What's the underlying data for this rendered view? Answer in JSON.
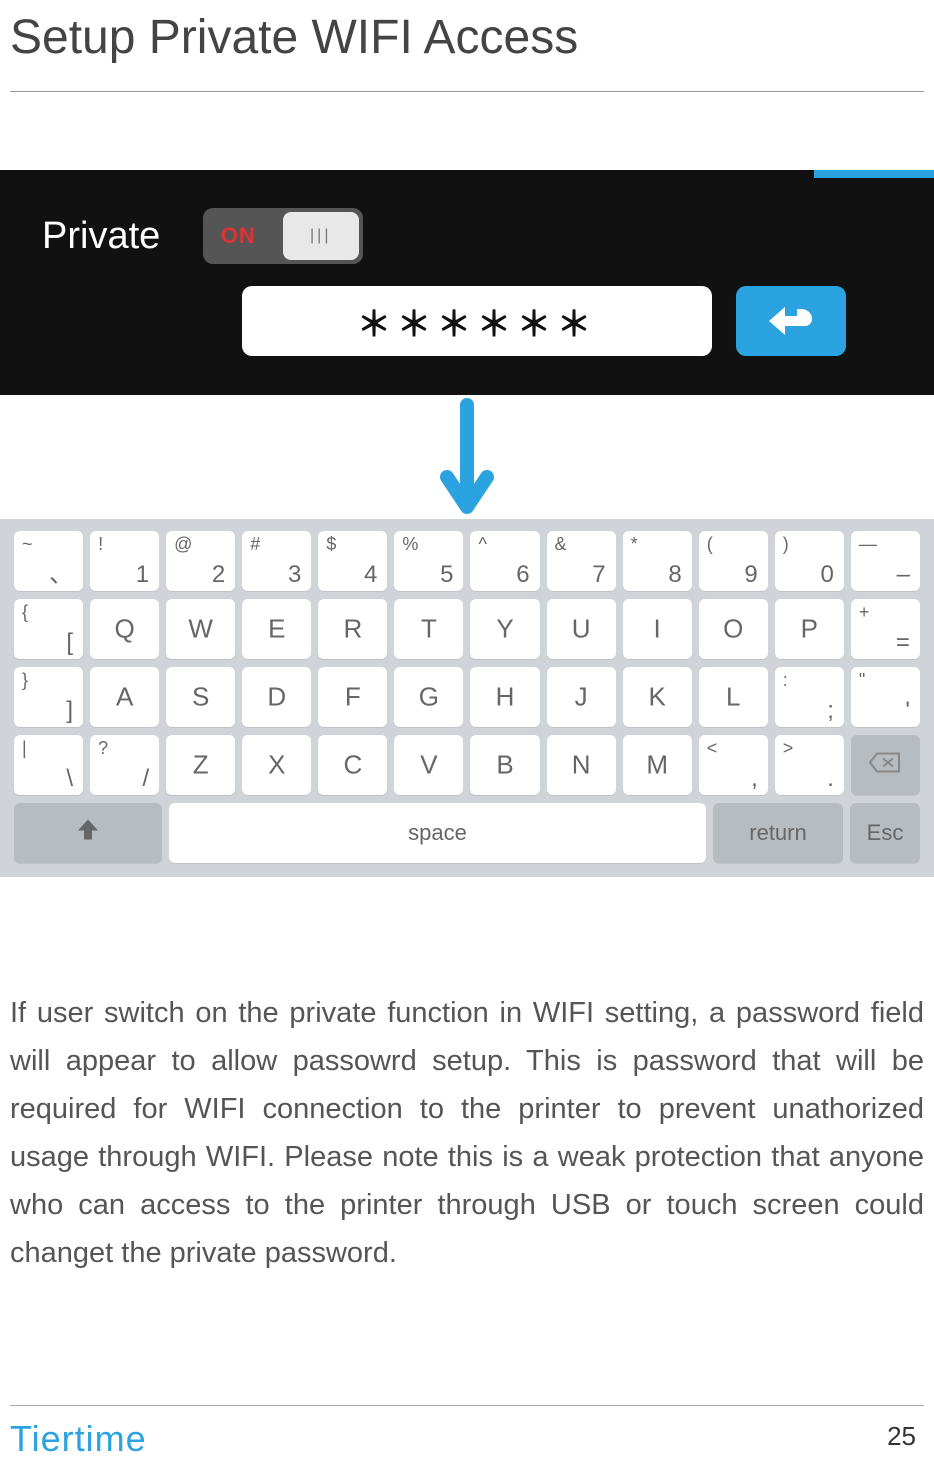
{
  "title": "Setup Private WIFI Access",
  "panel": {
    "private_label": "Private",
    "toggle_on": "ON",
    "toggle_knob_glyph": "|||",
    "password_masked": "＊＊＊＊＊＊"
  },
  "arrow_icon": "down-arrow",
  "keyboard": {
    "row1": [
      {
        "tl": "~",
        "br": "、"
      },
      {
        "tl": "!",
        "br": "1"
      },
      {
        "tl": "@",
        "br": "2"
      },
      {
        "tl": "#",
        "br": "3"
      },
      {
        "tl": "$",
        "br": "4"
      },
      {
        "tl": "%",
        "br": "5"
      },
      {
        "tl": "^",
        "br": "6"
      },
      {
        "tl": "&",
        "br": "7"
      },
      {
        "tl": "*",
        "br": "8"
      },
      {
        "tl": "(",
        "br": "9"
      },
      {
        "tl": ")",
        "br": "0"
      },
      {
        "tl": "—",
        "br": "–"
      }
    ],
    "row2": [
      {
        "tl": "{",
        "br": "["
      },
      {
        "c": "Q"
      },
      {
        "c": "W"
      },
      {
        "c": "E"
      },
      {
        "c": "R"
      },
      {
        "c": "T"
      },
      {
        "c": "Y"
      },
      {
        "c": "U"
      },
      {
        "c": "I"
      },
      {
        "c": "O"
      },
      {
        "c": "P"
      },
      {
        "tl": "+",
        "br": "="
      }
    ],
    "row3": [
      {
        "tl": "}",
        "br": "]"
      },
      {
        "c": "A"
      },
      {
        "c": "S"
      },
      {
        "c": "D"
      },
      {
        "c": "F"
      },
      {
        "c": "G"
      },
      {
        "c": "H"
      },
      {
        "c": "J"
      },
      {
        "c": "K"
      },
      {
        "c": "L"
      },
      {
        "tl": ":",
        "br": ";"
      },
      {
        "tl": "\"",
        "br": "'"
      }
    ],
    "row4": [
      {
        "tl": "|",
        "br": "\\"
      },
      {
        "tl": "?",
        "br": "/"
      },
      {
        "c": "Z"
      },
      {
        "c": "X"
      },
      {
        "c": "C"
      },
      {
        "c": "V"
      },
      {
        "c": "B"
      },
      {
        "c": "N"
      },
      {
        "c": "M"
      },
      {
        "tl": "<",
        "br": ","
      },
      {
        "tl": ">",
        "br": "."
      },
      {
        "bksp": true
      }
    ],
    "row5": {
      "shift": "⇧",
      "space": "space",
      "return": "return",
      "esc": "Esc"
    }
  },
  "body_text": "If user switch on the private function in WIFI setting, a password field will appear to allow passowrd setup. This is password that will be required for WIFI connection to the printer to prevent unathorized usage through WIFI. Please note this is a weak protection that anyone who can access to the printer through USB or touch screen could changet the private password.",
  "brand": "Tiertime",
  "page_number": "25",
  "colors": {
    "accent": "#2aa3e0",
    "on_red": "#d33"
  }
}
